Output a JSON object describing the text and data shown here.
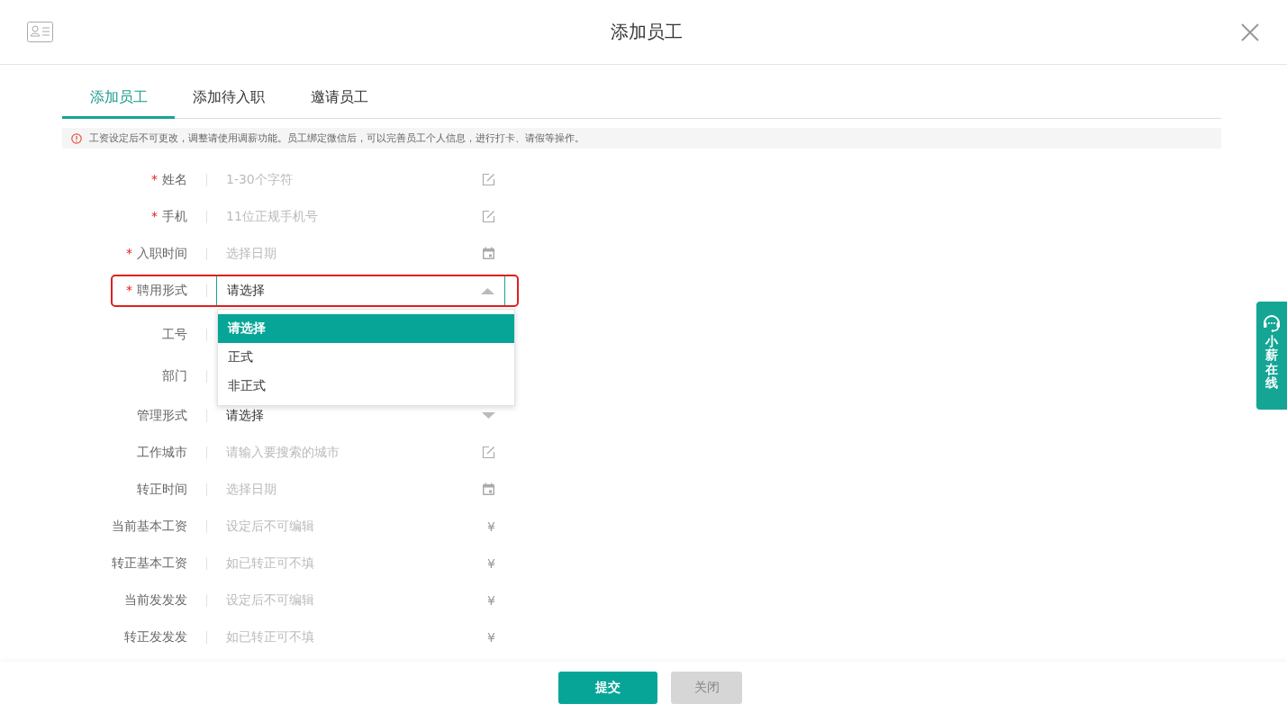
{
  "window": {
    "title": "添加员工"
  },
  "tabs": [
    {
      "label": "添加员工",
      "selected": true
    },
    {
      "label": "添加待入职",
      "selected": false
    },
    {
      "label": "邀请员工",
      "selected": false
    }
  ],
  "notice": "工资设定后不可更改，调整请使用调薪功能。员工绑定微信后，可以完善员工个人信息，进行打卡、请假等操作。",
  "fields": [
    {
      "label": "姓名",
      "required_mark": "*",
      "kind": "text",
      "placeholder": "1-30个字符"
    },
    {
      "label": "手机",
      "required_mark": "*",
      "kind": "text",
      "placeholder": "11位正规手机号"
    },
    {
      "label": "入职时间",
      "required_mark": "*",
      "kind": "date",
      "placeholder": "选择日期"
    },
    {
      "label": "聘用形式",
      "required_mark": "*",
      "kind": "select",
      "value": "请选择",
      "expanded": true,
      "highlighted": true,
      "options": [
        {
          "label": "请选择",
          "selected": true
        },
        {
          "label": "正式",
          "selected": false
        },
        {
          "label": "非正式",
          "selected": false
        }
      ]
    },
    {
      "label": "工号",
      "kind": "covered"
    },
    {
      "label": "部门",
      "kind": "covered"
    },
    {
      "label": "管理形式",
      "kind": "select",
      "value": "请选择",
      "expanded": false
    },
    {
      "label": "工作城市",
      "kind": "text",
      "placeholder": "请输入要搜索的城市"
    },
    {
      "label": "转正时间",
      "kind": "date",
      "placeholder": "选择日期"
    },
    {
      "label": "当前基本工资",
      "kind": "money",
      "placeholder": "设定后不可编辑",
      "unit": "¥"
    },
    {
      "label": "转正基本工资",
      "kind": "money",
      "placeholder": "如已转正可不填",
      "unit": "¥"
    },
    {
      "label": "当前发发发",
      "kind": "money",
      "placeholder": "设定后不可编辑",
      "unit": "¥"
    },
    {
      "label": "转正发发发",
      "kind": "money",
      "placeholder": "如已转正可不填",
      "unit": "¥"
    }
  ],
  "side_tab": {
    "label": "小薪在线"
  },
  "buttons": [
    {
      "label": "提交",
      "kind": "primary"
    },
    {
      "label": "关闭",
      "kind": "secondary"
    }
  ]
}
